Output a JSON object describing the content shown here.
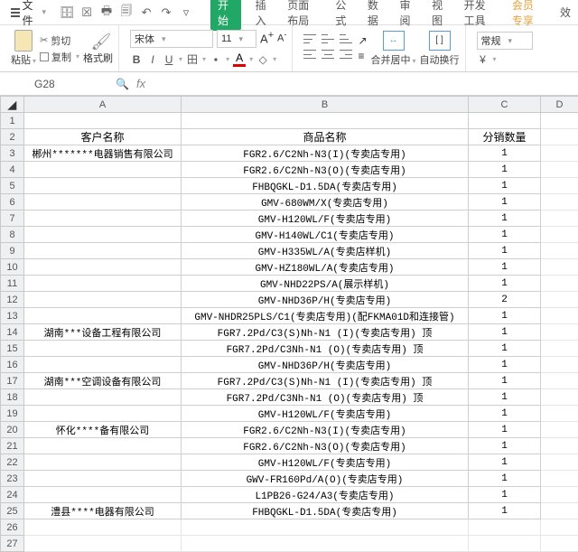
{
  "menu": {
    "file": "文件",
    "tabs": [
      "开始",
      "插入",
      "页面布局",
      "公式",
      "数据",
      "审阅",
      "视图",
      "开发工具",
      "会员专享",
      "效"
    ]
  },
  "ribbon": {
    "paste": "粘贴",
    "cut": "剪切",
    "copy": "复制",
    "format_painter": "格式刷",
    "font_name": "宋体",
    "font_size": "11",
    "merge_center": "合并居中",
    "wrap": "自动换行",
    "general": "常规"
  },
  "namebox": {
    "ref": "G28"
  },
  "columns": [
    "A",
    "B",
    "C",
    "D"
  ],
  "header": {
    "a": "客户名称",
    "b": "商品名称",
    "c": "分销数量"
  },
  "rows": [
    {
      "r": 3,
      "a": "郴州*******电器销售有限公司",
      "b": "FGR2.6/C2Nh-N3(I)(专卖店专用)",
      "c": "1"
    },
    {
      "r": 4,
      "a": "",
      "b": "FGR2.6/C2Nh-N3(O)(专卖店专用)",
      "c": "1"
    },
    {
      "r": 5,
      "a": "",
      "b": "FHBQGKL-D1.5DA(专卖店专用)",
      "c": "1"
    },
    {
      "r": 6,
      "a": "",
      "b": "GMV-680WM/X(专卖店专用)",
      "c": "1"
    },
    {
      "r": 7,
      "a": "",
      "b": "GMV-H120WL/F(专卖店专用)",
      "c": "1"
    },
    {
      "r": 8,
      "a": "",
      "b": "GMV-H140WL/C1(专卖店专用)",
      "c": "1"
    },
    {
      "r": 9,
      "a": "",
      "b": "GMV-H335WL/A(专卖店样机)",
      "c": "1"
    },
    {
      "r": 10,
      "a": "",
      "b": "GMV-HZ180WL/A(专卖店专用)",
      "c": "1"
    },
    {
      "r": 11,
      "a": "",
      "b": "GMV-NHD22PS/A(展示样机)",
      "c": "1"
    },
    {
      "r": 12,
      "a": "",
      "b": "GMV-NHD36P/H(专卖店专用)",
      "c": "2"
    },
    {
      "r": 13,
      "a": "",
      "b": "GMV-NHDR25PLS/C1(专卖店专用)(配FKMA01D和连接管)",
      "c": "1"
    },
    {
      "r": 14,
      "a": "湖南***设备工程有限公司",
      "b": "FGR7.2Pd/C3(S)Nh-N1 (I)(专卖店专用) 顶",
      "c": "1"
    },
    {
      "r": 15,
      "a": "",
      "b": "FGR7.2Pd/C3Nh-N1 (O)(专卖店专用) 顶",
      "c": "1"
    },
    {
      "r": 16,
      "a": "",
      "b": "GMV-NHD36P/H(专卖店专用)",
      "c": "1"
    },
    {
      "r": 17,
      "a": "湖南***空调设备有限公司",
      "b": "FGR7.2Pd/C3(S)Nh-N1 (I)(专卖店专用) 顶",
      "c": "1"
    },
    {
      "r": 18,
      "a": "",
      "b": "FGR7.2Pd/C3Nh-N1 (O)(专卖店专用) 顶",
      "c": "1"
    },
    {
      "r": 19,
      "a": "",
      "b": "GMV-H120WL/F(专卖店专用)",
      "c": "1"
    },
    {
      "r": 20,
      "a": "怀化****备有限公司",
      "b": "FGR2.6/C2Nh-N3(I)(专卖店专用)",
      "c": "1"
    },
    {
      "r": 21,
      "a": "",
      "b": "FGR2.6/C2Nh-N3(O)(专卖店专用)",
      "c": "1"
    },
    {
      "r": 22,
      "a": "",
      "b": "GMV-H120WL/F(专卖店专用)",
      "c": "1"
    },
    {
      "r": 23,
      "a": "",
      "b": "GWV-FR160Pd/A(O)(专卖店专用)",
      "c": "1"
    },
    {
      "r": 24,
      "a": "",
      "b": "L1PB26-G24/A3(专卖店专用)",
      "c": "1"
    },
    {
      "r": 25,
      "a": "澧县****电器有限公司",
      "b": "FHBQGKL-D1.5DA(专卖店专用)",
      "c": "1"
    }
  ]
}
